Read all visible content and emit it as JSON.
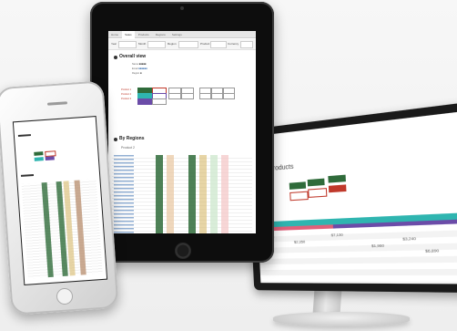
{
  "tablet": {
    "nav_tabs": [
      "Home",
      "Sales",
      "Products",
      "Regions",
      "Settings"
    ],
    "filters": [
      "Year",
      "Month",
      "Region",
      "Product",
      "Currency",
      "Apply"
    ],
    "section_overall": "Overall view",
    "meta_labels": [
      "Name",
      "Email",
      "Region"
    ],
    "product_labels": [
      "Product 1",
      "Product 2",
      "Product 3"
    ],
    "section_regions": "By Regions",
    "product_label": "Product 2"
  },
  "monitor": {
    "title": "Products",
    "row_values": [
      "$4,500",
      "$2,350",
      "$7,130",
      "$1,960",
      "$3,240",
      "$6,890"
    ]
  },
  "colors": {
    "dark_green": "#2f6b3a",
    "pink": "#e0607a",
    "teal": "#2fb5b0",
    "purple": "#6b4ca8",
    "gold": "#d7b96a",
    "red": "#c0392b"
  }
}
